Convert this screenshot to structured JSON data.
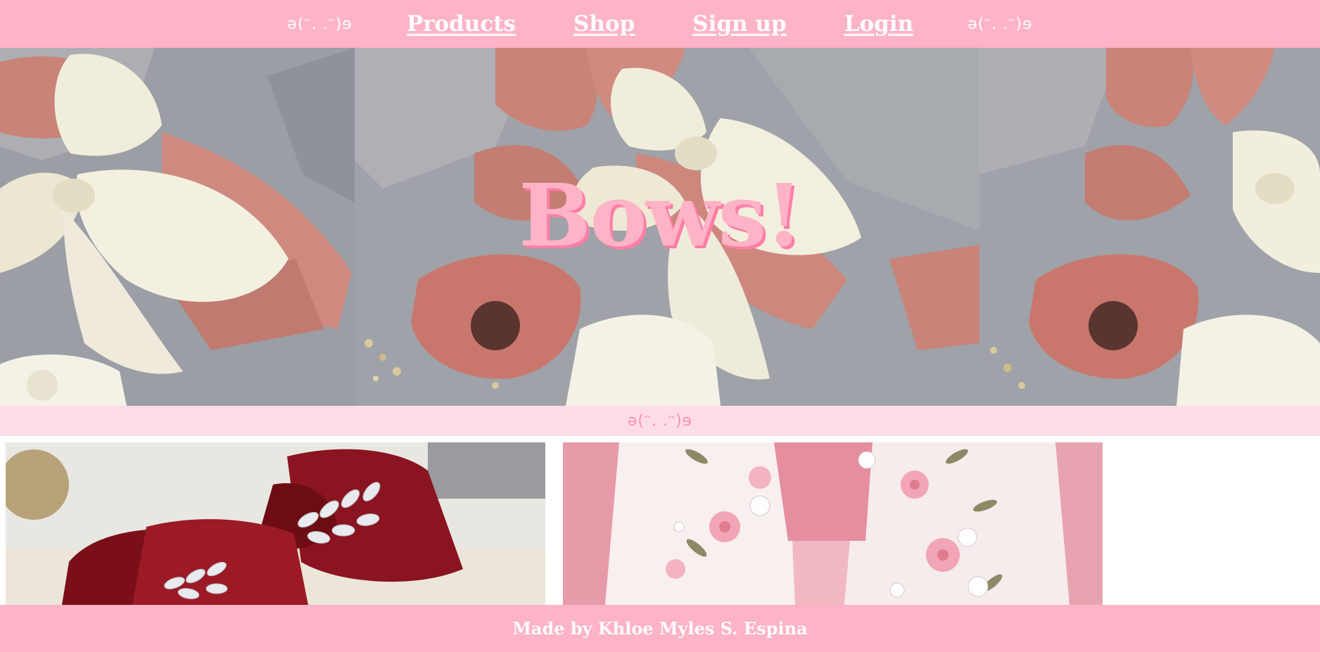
{
  "nav": {
    "decor_left": "ə(ᵔ. .ᵔ)ɘ",
    "decor_right": "ə(ᵔ. .ᵔ)ɘ",
    "links": [
      "Products",
      "Shop",
      "Sign up",
      "Login"
    ]
  },
  "hero": {
    "title": "Bows!",
    "image_description_icons": [
      "satin-bow-image",
      "satin-bow-image",
      "satin-bow-image"
    ]
  },
  "strip": {
    "decor": "ə(ᵔ. .ᵔ)ɘ"
  },
  "gallery": {
    "items": [
      "velvet-bow-image",
      "embroidered-bow-image"
    ]
  },
  "footer": {
    "credit": "Made by Khloe Myles S. Espina"
  },
  "colors": {
    "nav_bg": "#ffb3c6",
    "strip_bg": "#ffdde6",
    "title_pink": "#ffb3c6",
    "title_shadow": "#ff7fa8",
    "text_white": "#ffffff"
  }
}
